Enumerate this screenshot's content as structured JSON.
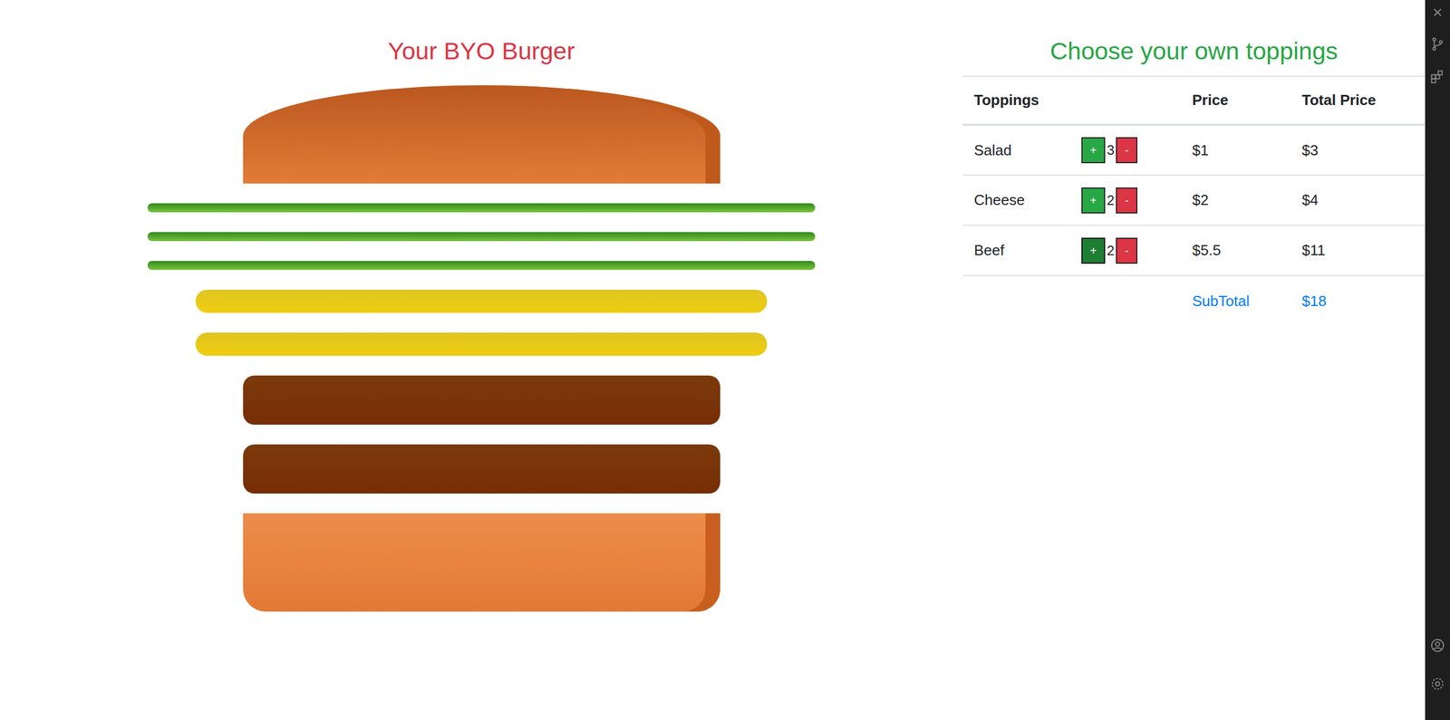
{
  "burger": {
    "title": "Your BYO Burger"
  },
  "toppings_panel": {
    "title": "Choose your own toppings"
  },
  "table": {
    "columns": {
      "toppings": "Toppings",
      "price": "Price",
      "total": "Total Price"
    },
    "rows": [
      {
        "kind": "salad",
        "name": "Salad",
        "plus": "+",
        "count": "3",
        "minus": "-",
        "price": "$1",
        "total": "$3",
        "plus_pressed": false
      },
      {
        "kind": "cheese",
        "name": "Cheese",
        "plus": "+",
        "count": "2",
        "minus": "-",
        "price": "$2",
        "total": "$4",
        "plus_pressed": false
      },
      {
        "kind": "beef",
        "name": "Beef",
        "plus": "+",
        "count": "2",
        "minus": "-",
        "price": "$5.5",
        "total": "$11",
        "plus_pressed": true
      }
    ],
    "subtotal": {
      "label": "SubTotal",
      "value": "$18"
    }
  }
}
